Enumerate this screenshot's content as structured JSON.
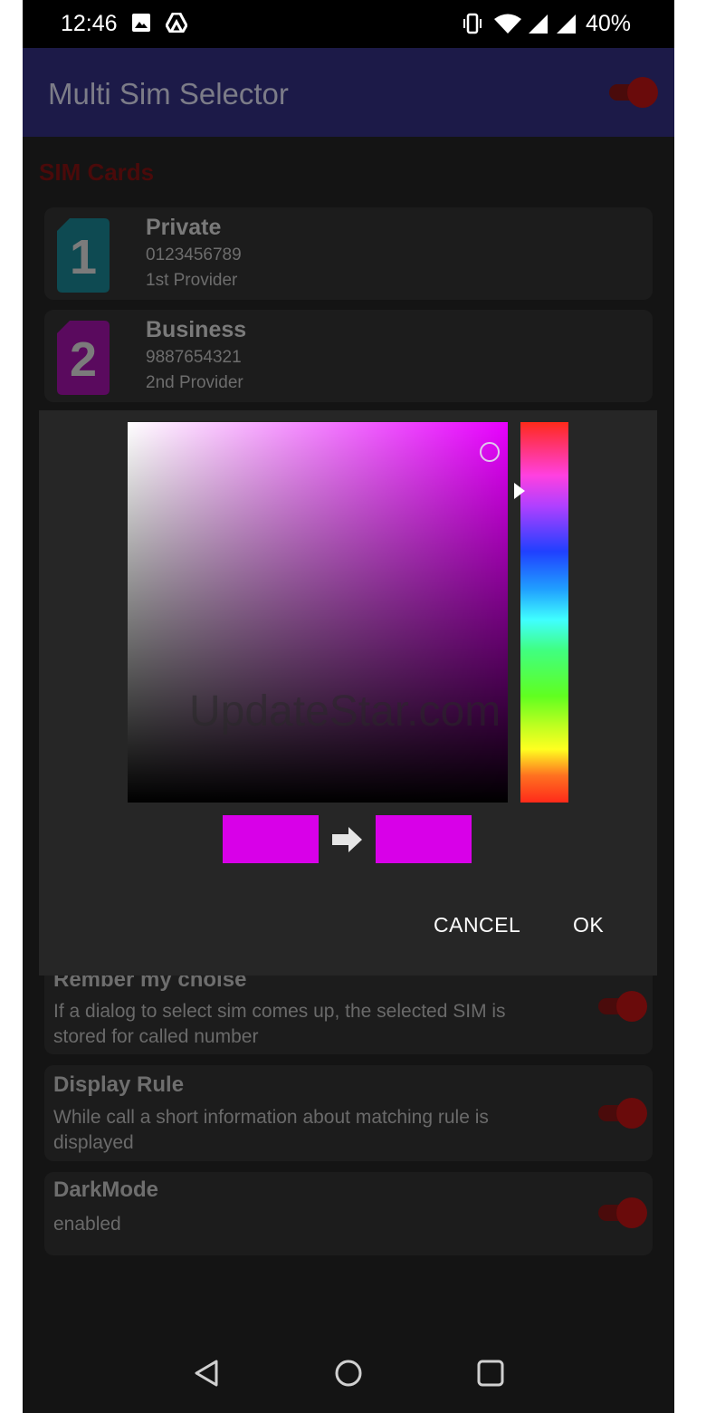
{
  "status_bar": {
    "time": "12:46",
    "battery": "40%"
  },
  "app_bar": {
    "title": "Multi Sim Selector"
  },
  "section": {
    "sim_cards_title": "SIM Cards"
  },
  "sims": [
    {
      "number_badge": "1",
      "name": "Private",
      "phone": "0123456789",
      "provider": "1st Provider",
      "color": "#0e4a52"
    },
    {
      "number_badge": "2",
      "name": "Business",
      "phone": "9887654321",
      "provider": "2nd Provider",
      "color": "#5a0a5e"
    }
  ],
  "settings": [
    {
      "title": "Rember my choise",
      "description": "If a dialog to select sim comes up, the selected SIM is stored for called number"
    },
    {
      "title": "Display Rule",
      "description": "While call a short information about matching rule is displayed"
    },
    {
      "title": "DarkMode",
      "description": "enabled"
    }
  ],
  "color_dialog": {
    "watermark": "UpdateStar.com",
    "old_color": "#d800e8",
    "new_color": "#d800e8",
    "cancel_label": "CANCEL",
    "ok_label": "OK"
  },
  "icons": [
    "image-icon",
    "drive-icon",
    "vibrate-icon",
    "wifi-icon",
    "signal-icon",
    "signal-icon-2",
    "back-icon",
    "home-icon",
    "recents-icon"
  ]
}
